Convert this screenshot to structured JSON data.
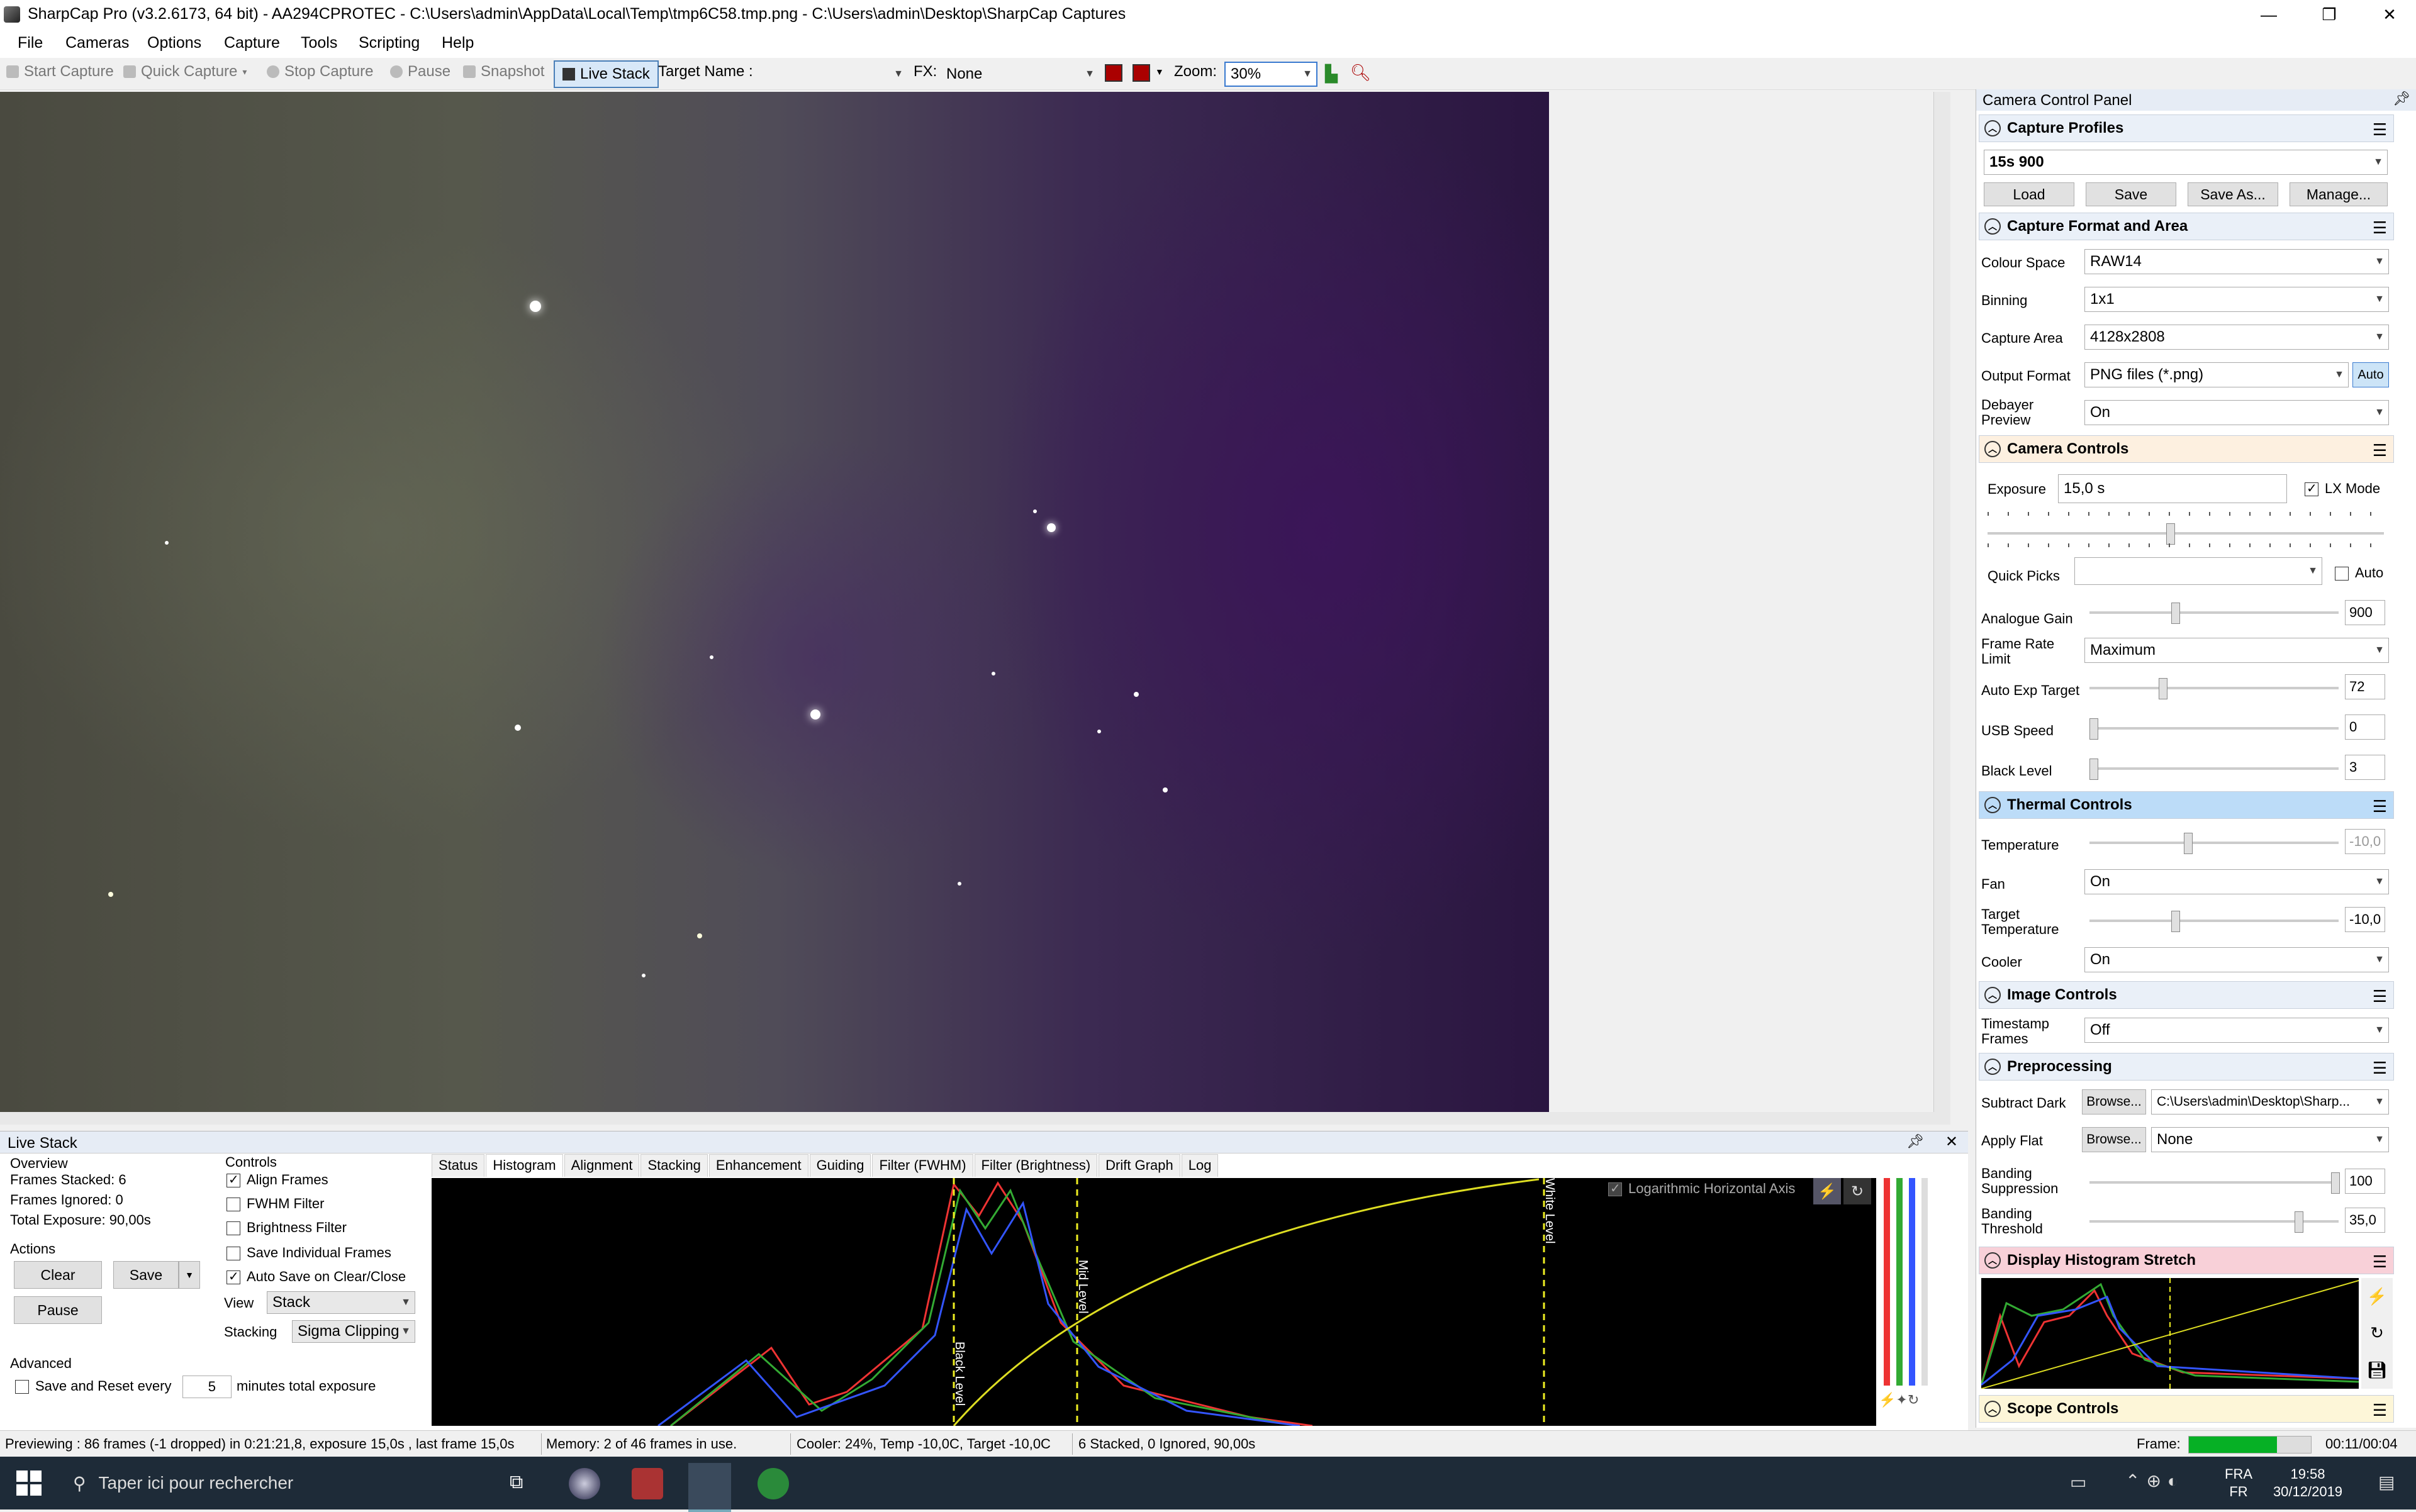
{
  "window": {
    "title": "SharpCap Pro (v3.2.6173, 64 bit) - AA294CPROTEC - C:\\Users\\admin\\AppData\\Local\\Temp\\tmp6C58.tmp.png - C:\\Users\\admin\\Desktop\\SharpCap Captures",
    "minimize": "—",
    "maximize": "❐",
    "close": "✕"
  },
  "menu": [
    "File",
    "Cameras",
    "Options",
    "Capture",
    "Tools",
    "Scripting",
    "Help"
  ],
  "toolbar": {
    "start_capture": "Start Capture",
    "quick_capture": "Quick Capture",
    "stop_capture": "Stop Capture",
    "pause": "Pause",
    "snapshot": "Snapshot",
    "live_stack": "Live Stack",
    "target_name_label": "Target Name :",
    "target_name_value": "",
    "fx_label": "FX:",
    "fx_value": "None",
    "zoom_label": "Zoom:",
    "zoom_value": "30%"
  },
  "live_stack": {
    "panel_title": "Live Stack",
    "overview_label": "Overview",
    "frames_stacked": "Frames Stacked:  6",
    "frames_ignored": "Frames Ignored:   0",
    "total_exposure": "Total Exposure:   90,00s",
    "actions_label": "Actions",
    "clear": "Clear",
    "save": "Save",
    "pause": "Pause",
    "advanced_label": "Advanced",
    "save_reset_label": "Save and Reset every",
    "save_reset_value": "5",
    "save_reset_unit": "minutes total exposure",
    "controls_label": "Controls",
    "controls": [
      {
        "label": "Align Frames",
        "checked": true
      },
      {
        "label": "FWHM Filter",
        "checked": false
      },
      {
        "label": "Brightness Filter",
        "checked": false
      },
      {
        "label": "Save Individual Frames",
        "checked": false
      },
      {
        "label": "Auto Save on Clear/Close",
        "checked": true
      }
    ],
    "view_label": "View",
    "view_value": "Stack",
    "stacking_label": "Stacking",
    "stacking_value": "Sigma Clipping",
    "tabs": [
      "Status",
      "Histogram",
      "Alignment",
      "Stacking",
      "Enhancement",
      "Guiding",
      "Filter (FWHM)",
      "Filter (Brightness)",
      "Drift Graph",
      "Log"
    ],
    "active_tab": "Histogram",
    "hist_log_axis": "Logarithmic Horizontal Axis",
    "black_level": "Black Level",
    "mid_level": "Mid Level",
    "white_level": "White Level"
  },
  "status": {
    "preview": "Previewing : 86 frames (-1 dropped) in 0:21:21,8, exposure 15,0s , last frame 15,0s",
    "memory": "Memory: 2 of 46 frames in use.",
    "cooler": "Cooler: 24%, Temp -10,0C, Target -10,0C",
    "stacked": "6 Stacked, 0 Ignored, 90,00s",
    "frame_label": "Frame:",
    "frame_progress": 0.72,
    "elapsed": "00:11/00:04"
  },
  "ccp": {
    "title": "Camera Control Panel",
    "capture_profiles": {
      "title": "Capture Profiles",
      "value": "15s 900",
      "load": "Load",
      "save": "Save",
      "save_as": "Save As...",
      "manage": "Manage..."
    },
    "capture_format": {
      "title": "Capture Format and Area",
      "colour_space_label": "Colour Space",
      "colour_space": "RAW14",
      "binning_label": "Binning",
      "binning": "1x1",
      "capture_area_label": "Capture Area",
      "capture_area": "4128x2808",
      "output_format_label": "Output Format",
      "output_format": "PNG files (*.png)",
      "auto": "Auto",
      "debayer_label": "Debayer Preview",
      "debayer": "On"
    },
    "camera_controls": {
      "title": "Camera Controls",
      "exposure_label": "Exposure",
      "exposure": "15,0 s",
      "lx_mode": "LX Mode",
      "quick_picks_label": "Quick Picks",
      "quick_picks_auto": "Auto",
      "analogue_gain_label": "Analogue Gain",
      "analogue_gain": "900",
      "frame_rate_label": "Frame Rate Limit",
      "frame_rate": "Maximum",
      "auto_exp_label": "Auto Exp Target",
      "auto_exp": "72",
      "usb_speed_label": "USB Speed",
      "usb_speed": "0",
      "black_level_label": "Black Level",
      "black_level": "3"
    },
    "thermal": {
      "title": "Thermal Controls",
      "temperature_label": "Temperature",
      "temperature": "-10,0",
      "fan_label": "Fan",
      "fan": "On",
      "target_temp_label": "Target Temperature",
      "target_temp": "-10,0",
      "cooler_label": "Cooler",
      "cooler": "On"
    },
    "image_controls": {
      "title": "Image Controls",
      "timestamp_label": "Timestamp Frames",
      "timestamp": "Off"
    },
    "preprocessing": {
      "title": "Preprocessing",
      "subtract_dark_label": "Subtract Dark",
      "browse": "Browse...",
      "subtract_dark": "C:\\Users\\admin\\Desktop\\Sharp...",
      "apply_flat_label": "Apply Flat",
      "apply_flat": "None",
      "banding_supp_label": "Banding Suppression",
      "banding_supp": "100",
      "banding_thresh_label": "Banding Threshold",
      "banding_thresh": "35,0"
    },
    "display_histogram": {
      "title": "Display Histogram Stretch"
    },
    "scope_controls": {
      "title": "Scope Controls"
    }
  },
  "taskbar": {
    "search": "Taper ici pour rechercher",
    "lang_top": "FRA",
    "lang_bottom": "FR",
    "time": "19:58",
    "date": "30/12/2019"
  }
}
